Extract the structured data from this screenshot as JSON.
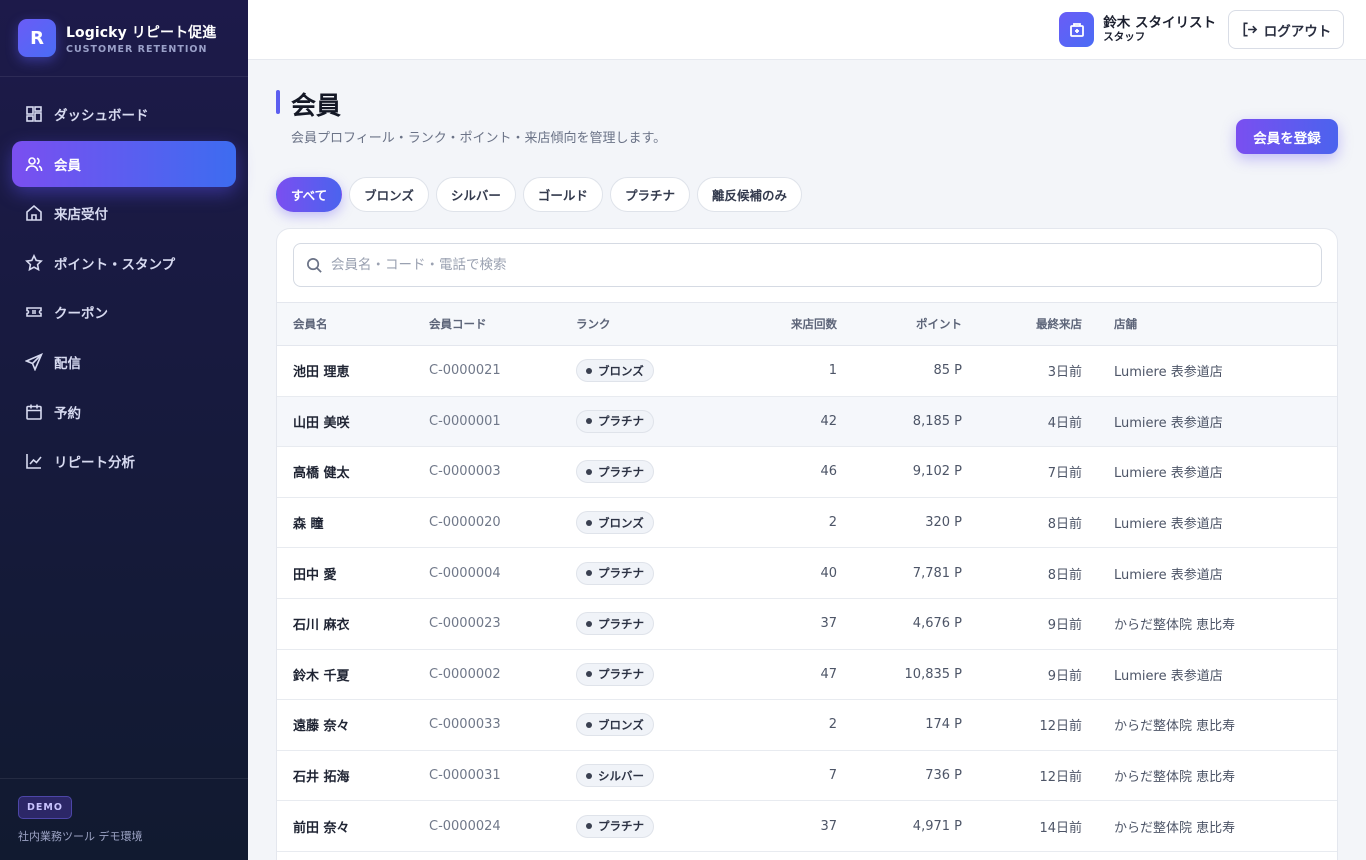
{
  "brand": {
    "logo_letter": "R",
    "title": "Logicky リピート促進",
    "subtitle": "CUSTOMER RETENTION"
  },
  "sidebar": {
    "items": [
      {
        "label": "ダッシュボード",
        "icon": "dashboard-icon"
      },
      {
        "label": "会員",
        "icon": "users-icon",
        "active": true
      },
      {
        "label": "来店受付",
        "icon": "home-icon"
      },
      {
        "label": "ポイント・スタンプ",
        "icon": "star-icon"
      },
      {
        "label": "クーポン",
        "icon": "ticket-icon"
      },
      {
        "label": "配信",
        "icon": "send-icon"
      },
      {
        "label": "予約",
        "icon": "calendar-icon"
      },
      {
        "label": "リピート分析",
        "icon": "chart-icon"
      }
    ],
    "footer": {
      "badge": "DEMO",
      "text": "社内業務ツール デモ環境"
    }
  },
  "header": {
    "user_name": "鈴木 スタイリスト",
    "user_role": "スタッフ",
    "logout_label": "ログアウト"
  },
  "page": {
    "title": "会員",
    "subtitle": "会員プロフィール・ランク・ポイント・来店傾向を管理します。",
    "register_label": "会員を登録"
  },
  "filters": [
    "すべて",
    "ブロンズ",
    "シルバー",
    "ゴールド",
    "プラチナ",
    "離反候補のみ"
  ],
  "search": {
    "placeholder": "会員名・コード・電話で検索",
    "value": ""
  },
  "table": {
    "columns": [
      "会員名",
      "会員コード",
      "ランク",
      "来店回数",
      "ポイント",
      "最終来店",
      "店舗"
    ],
    "rows": [
      {
        "name": "池田 理恵",
        "code": "C-0000021",
        "rank": "ブロンズ",
        "visits": "1",
        "points": "85 P",
        "last": "3日前",
        "store": "Lumiere 表参道店"
      },
      {
        "name": "山田 美咲",
        "code": "C-0000001",
        "rank": "プラチナ",
        "visits": "42",
        "points": "8,185 P",
        "last": "4日前",
        "store": "Lumiere 表参道店"
      },
      {
        "name": "高橋 健太",
        "code": "C-0000003",
        "rank": "プラチナ",
        "visits": "46",
        "points": "9,102 P",
        "last": "7日前",
        "store": "Lumiere 表参道店"
      },
      {
        "name": "森 瞳",
        "code": "C-0000020",
        "rank": "ブロンズ",
        "visits": "2",
        "points": "320 P",
        "last": "8日前",
        "store": "Lumiere 表参道店"
      },
      {
        "name": "田中 愛",
        "code": "C-0000004",
        "rank": "プラチナ",
        "visits": "40",
        "points": "7,781 P",
        "last": "8日前",
        "store": "Lumiere 表参道店"
      },
      {
        "name": "石川 麻衣",
        "code": "C-0000023",
        "rank": "プラチナ",
        "visits": "37",
        "points": "4,676 P",
        "last": "9日前",
        "store": "からだ整体院 恵比寿"
      },
      {
        "name": "鈴木 千夏",
        "code": "C-0000002",
        "rank": "プラチナ",
        "visits": "47",
        "points": "10,835 P",
        "last": "9日前",
        "store": "Lumiere 表参道店"
      },
      {
        "name": "遠藤 奈々",
        "code": "C-0000033",
        "rank": "ブロンズ",
        "visits": "2",
        "points": "174 P",
        "last": "12日前",
        "store": "からだ整体院 恵比寿"
      },
      {
        "name": "石井 拓海",
        "code": "C-0000031",
        "rank": "シルバー",
        "visits": "7",
        "points": "736 P",
        "last": "12日前",
        "store": "からだ整体院 恵比寿"
      },
      {
        "name": "前田 奈々",
        "code": "C-0000024",
        "rank": "プラチナ",
        "visits": "37",
        "points": "4,971 P",
        "last": "14日前",
        "store": "からだ整体院 恵比寿"
      }
    ]
  }
}
